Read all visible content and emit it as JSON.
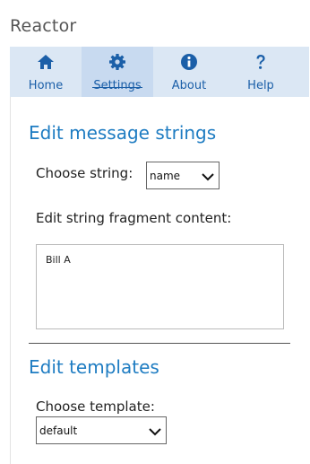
{
  "app": {
    "title": "Reactor"
  },
  "tabs": [
    {
      "label": "Home",
      "icon": "home-icon"
    },
    {
      "label": "Settings",
      "icon": "gear-icon"
    },
    {
      "label": "About",
      "icon": "info-icon"
    },
    {
      "label": "Help",
      "icon": "help-icon"
    }
  ],
  "active_tab": "Settings",
  "colors": {
    "accent": "#1e7cc2",
    "tab_background": "#dbe7f4",
    "tab_active": "#c8daf0",
    "tab_label": "#1b5fa8"
  },
  "message_strings": {
    "title": "Edit message strings",
    "choose_label": "Choose string:",
    "choose_value": "name",
    "fragment_label": "Edit string fragment content:",
    "fragment_value": "Bill A"
  },
  "templates": {
    "title": "Edit templates",
    "choose_label": "Choose template:",
    "choose_value": "default"
  }
}
